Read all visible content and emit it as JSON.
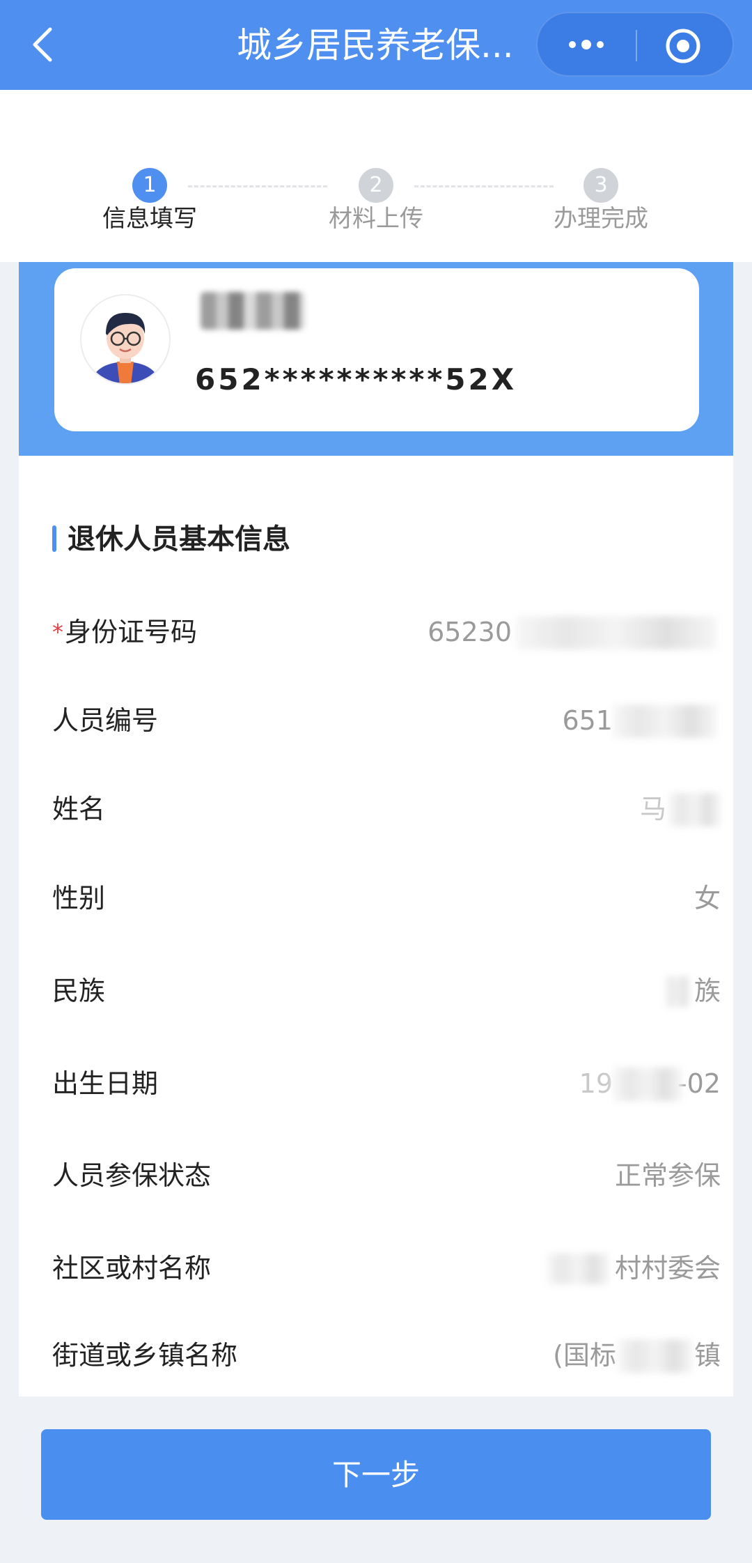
{
  "nav": {
    "title": "城乡居民养老保..."
  },
  "steps": [
    {
      "number": "1",
      "label": "信息填写",
      "active": true
    },
    {
      "number": "2",
      "label": "材料上传",
      "active": false
    },
    {
      "number": "3",
      "label": "办理完成",
      "active": false
    }
  ],
  "colors": {
    "primary": "#4f8ff0",
    "inactive_step": "#d0d3d8",
    "required": "#e04040"
  },
  "user_card": {
    "id_masked": "652**********52X"
  },
  "section": {
    "title": "退休人员基本信息",
    "required_mark": "*",
    "fields": [
      {
        "label": "身份证号码",
        "value": "65230",
        "required": true
      },
      {
        "label": "人员编号",
        "value": "651",
        "required": false
      },
      {
        "label": "姓名",
        "value": "马",
        "required": false
      },
      {
        "label": "性别",
        "value": "女",
        "required": false
      },
      {
        "label": "民族",
        "value": "族",
        "required": false
      },
      {
        "label": "出生日期",
        "value": "19",
        "value_suffix": "-02",
        "required": false
      },
      {
        "label": "人员参保状态",
        "value": "正常参保",
        "required": false
      },
      {
        "label": "社区或村名称",
        "value": "村村委会",
        "required": false
      },
      {
        "label": "街道或乡镇名称",
        "value": "(国标",
        "value_suffix": "镇",
        "required": false
      }
    ]
  },
  "footer": {
    "next_label": "下一步"
  },
  "icons": [
    "back-arrow-icon",
    "more-icon",
    "target-icon",
    "avatar"
  ]
}
